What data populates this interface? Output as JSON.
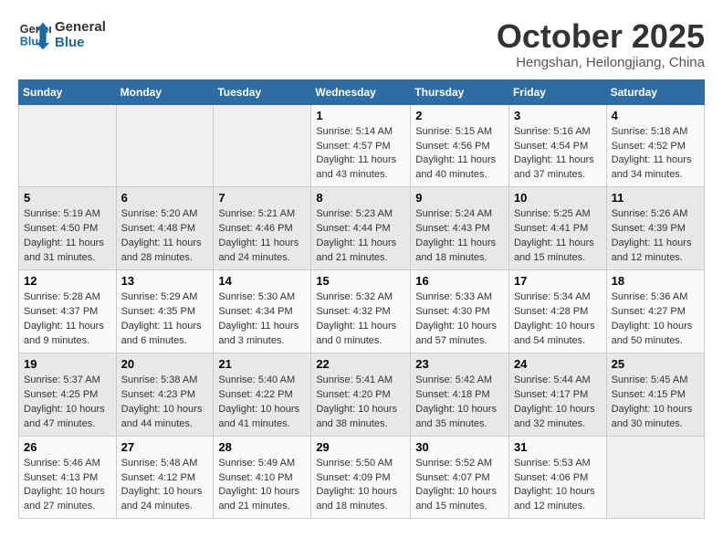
{
  "header": {
    "logo_general": "General",
    "logo_blue": "Blue",
    "month_title": "October 2025",
    "location": "Hengshan, Heilongjiang, China"
  },
  "weekdays": [
    "Sunday",
    "Monday",
    "Tuesday",
    "Wednesday",
    "Thursday",
    "Friday",
    "Saturday"
  ],
  "weeks": [
    [
      {
        "day": "",
        "info": ""
      },
      {
        "day": "",
        "info": ""
      },
      {
        "day": "",
        "info": ""
      },
      {
        "day": "1",
        "info": "Sunrise: 5:14 AM\nSunset: 4:57 PM\nDaylight: 11 hours\nand 43 minutes."
      },
      {
        "day": "2",
        "info": "Sunrise: 5:15 AM\nSunset: 4:56 PM\nDaylight: 11 hours\nand 40 minutes."
      },
      {
        "day": "3",
        "info": "Sunrise: 5:16 AM\nSunset: 4:54 PM\nDaylight: 11 hours\nand 37 minutes."
      },
      {
        "day": "4",
        "info": "Sunrise: 5:18 AM\nSunset: 4:52 PM\nDaylight: 11 hours\nand 34 minutes."
      }
    ],
    [
      {
        "day": "5",
        "info": "Sunrise: 5:19 AM\nSunset: 4:50 PM\nDaylight: 11 hours\nand 31 minutes."
      },
      {
        "day": "6",
        "info": "Sunrise: 5:20 AM\nSunset: 4:48 PM\nDaylight: 11 hours\nand 28 minutes."
      },
      {
        "day": "7",
        "info": "Sunrise: 5:21 AM\nSunset: 4:46 PM\nDaylight: 11 hours\nand 24 minutes."
      },
      {
        "day": "8",
        "info": "Sunrise: 5:23 AM\nSunset: 4:44 PM\nDaylight: 11 hours\nand 21 minutes."
      },
      {
        "day": "9",
        "info": "Sunrise: 5:24 AM\nSunset: 4:43 PM\nDaylight: 11 hours\nand 18 minutes."
      },
      {
        "day": "10",
        "info": "Sunrise: 5:25 AM\nSunset: 4:41 PM\nDaylight: 11 hours\nand 15 minutes."
      },
      {
        "day": "11",
        "info": "Sunrise: 5:26 AM\nSunset: 4:39 PM\nDaylight: 11 hours\nand 12 minutes."
      }
    ],
    [
      {
        "day": "12",
        "info": "Sunrise: 5:28 AM\nSunset: 4:37 PM\nDaylight: 11 hours\nand 9 minutes."
      },
      {
        "day": "13",
        "info": "Sunrise: 5:29 AM\nSunset: 4:35 PM\nDaylight: 11 hours\nand 6 minutes."
      },
      {
        "day": "14",
        "info": "Sunrise: 5:30 AM\nSunset: 4:34 PM\nDaylight: 11 hours\nand 3 minutes."
      },
      {
        "day": "15",
        "info": "Sunrise: 5:32 AM\nSunset: 4:32 PM\nDaylight: 11 hours\nand 0 minutes."
      },
      {
        "day": "16",
        "info": "Sunrise: 5:33 AM\nSunset: 4:30 PM\nDaylight: 10 hours\nand 57 minutes."
      },
      {
        "day": "17",
        "info": "Sunrise: 5:34 AM\nSunset: 4:28 PM\nDaylight: 10 hours\nand 54 minutes."
      },
      {
        "day": "18",
        "info": "Sunrise: 5:36 AM\nSunset: 4:27 PM\nDaylight: 10 hours\nand 50 minutes."
      }
    ],
    [
      {
        "day": "19",
        "info": "Sunrise: 5:37 AM\nSunset: 4:25 PM\nDaylight: 10 hours\nand 47 minutes."
      },
      {
        "day": "20",
        "info": "Sunrise: 5:38 AM\nSunset: 4:23 PM\nDaylight: 10 hours\nand 44 minutes."
      },
      {
        "day": "21",
        "info": "Sunrise: 5:40 AM\nSunset: 4:22 PM\nDaylight: 10 hours\nand 41 minutes."
      },
      {
        "day": "22",
        "info": "Sunrise: 5:41 AM\nSunset: 4:20 PM\nDaylight: 10 hours\nand 38 minutes."
      },
      {
        "day": "23",
        "info": "Sunrise: 5:42 AM\nSunset: 4:18 PM\nDaylight: 10 hours\nand 35 minutes."
      },
      {
        "day": "24",
        "info": "Sunrise: 5:44 AM\nSunset: 4:17 PM\nDaylight: 10 hours\nand 32 minutes."
      },
      {
        "day": "25",
        "info": "Sunrise: 5:45 AM\nSunset: 4:15 PM\nDaylight: 10 hours\nand 30 minutes."
      }
    ],
    [
      {
        "day": "26",
        "info": "Sunrise: 5:46 AM\nSunset: 4:13 PM\nDaylight: 10 hours\nand 27 minutes."
      },
      {
        "day": "27",
        "info": "Sunrise: 5:48 AM\nSunset: 4:12 PM\nDaylight: 10 hours\nand 24 minutes."
      },
      {
        "day": "28",
        "info": "Sunrise: 5:49 AM\nSunset: 4:10 PM\nDaylight: 10 hours\nand 21 minutes."
      },
      {
        "day": "29",
        "info": "Sunrise: 5:50 AM\nSunset: 4:09 PM\nDaylight: 10 hours\nand 18 minutes."
      },
      {
        "day": "30",
        "info": "Sunrise: 5:52 AM\nSunset: 4:07 PM\nDaylight: 10 hours\nand 15 minutes."
      },
      {
        "day": "31",
        "info": "Sunrise: 5:53 AM\nSunset: 4:06 PM\nDaylight: 10 hours\nand 12 minutes."
      },
      {
        "day": "",
        "info": ""
      }
    ]
  ]
}
